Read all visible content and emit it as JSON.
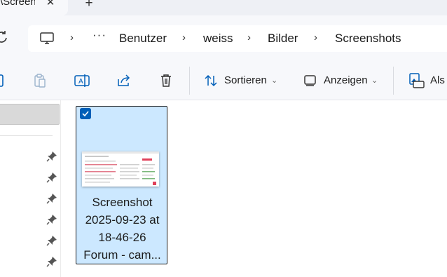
{
  "tab": {
    "title": "\\Screenshots",
    "close_icon": "close-icon",
    "new_tab_icon": "plus-icon"
  },
  "address": {
    "refresh_icon": "refresh-icon",
    "root_icon": "this-pc-icon",
    "more_label": "···",
    "separator": "›",
    "items": [
      {
        "label": "Benutzer"
      },
      {
        "label": "weiss"
      },
      {
        "label": "Bilder"
      },
      {
        "label": "Screenshots"
      }
    ]
  },
  "commandbar": {
    "icons": [
      "copy-icon",
      "paste-icon",
      "rename-icon",
      "share-icon",
      "delete-icon"
    ],
    "sort_label": "Sortieren",
    "view_label": "Anzeigen",
    "setas_label": "Als"
  },
  "nav": {
    "pinned_count": 6,
    "pin_icon": "pin-icon"
  },
  "file": {
    "name_lines": [
      "Screenshot",
      "2025-09-23 at",
      "18-46-26",
      "Forum - cam..."
    ],
    "selected": true
  },
  "colors": {
    "selection_fill": "#cce8ff",
    "accent": "#005fb8",
    "chrome_bg": "#f7f8fb"
  }
}
